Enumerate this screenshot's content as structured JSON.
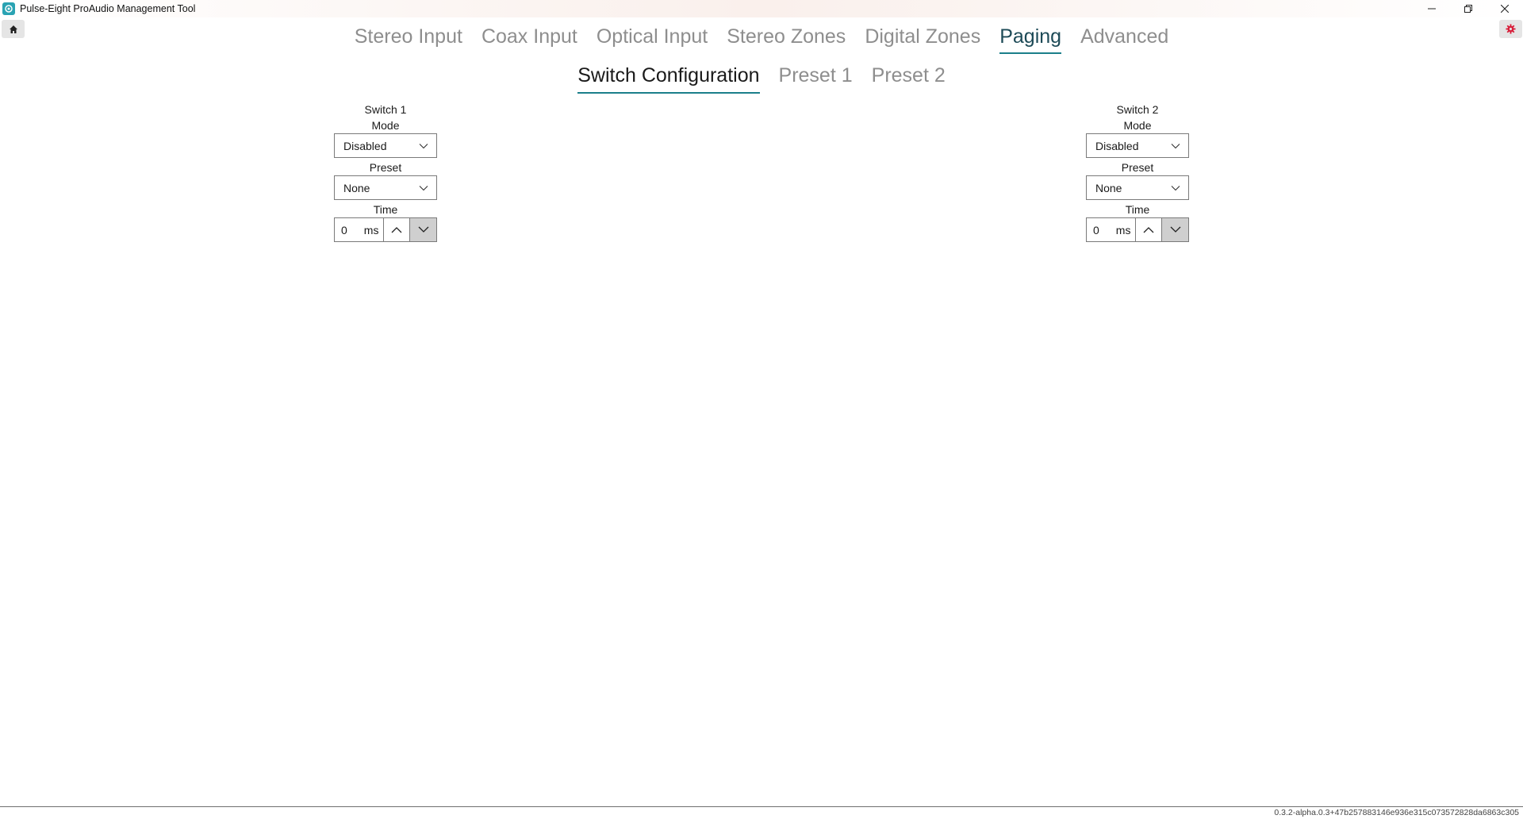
{
  "window": {
    "title": "Pulse-Eight ProAudio Management Tool",
    "icon": "app-logo-icon"
  },
  "toolbar": {
    "home_icon": "home-icon",
    "settings_icon": "gear-icon",
    "settings_color": "#d81e3a"
  },
  "main_tabs": [
    {
      "label": "Stereo Input",
      "active": false
    },
    {
      "label": "Coax Input",
      "active": false
    },
    {
      "label": "Optical Input",
      "active": false
    },
    {
      "label": "Stereo Zones",
      "active": false
    },
    {
      "label": "Digital Zones",
      "active": false
    },
    {
      "label": "Paging",
      "active": true
    },
    {
      "label": "Advanced",
      "active": false
    }
  ],
  "sub_tabs": [
    {
      "label": "Switch Configuration",
      "active": true
    },
    {
      "label": "Preset 1",
      "active": false
    },
    {
      "label": "Preset 2",
      "active": false
    }
  ],
  "switches": [
    {
      "title": "Switch 1",
      "mode_label": "Mode",
      "mode_value": "Disabled",
      "preset_label": "Preset",
      "preset_value": "None",
      "time_label": "Time",
      "time_value": "0",
      "time_unit": "ms"
    },
    {
      "title": "Switch 2",
      "mode_label": "Mode",
      "mode_value": "Disabled",
      "preset_label": "Preset",
      "preset_value": "None",
      "time_label": "Time",
      "time_value": "0",
      "time_unit": "ms"
    }
  ],
  "footer": {
    "version": "0.3.2-alpha.0.3+47b257883146e936e315c073572828da6863c305"
  },
  "colors": {
    "accent": "#1b7f8a",
    "inactive_tab": "#8e8e8e"
  }
}
